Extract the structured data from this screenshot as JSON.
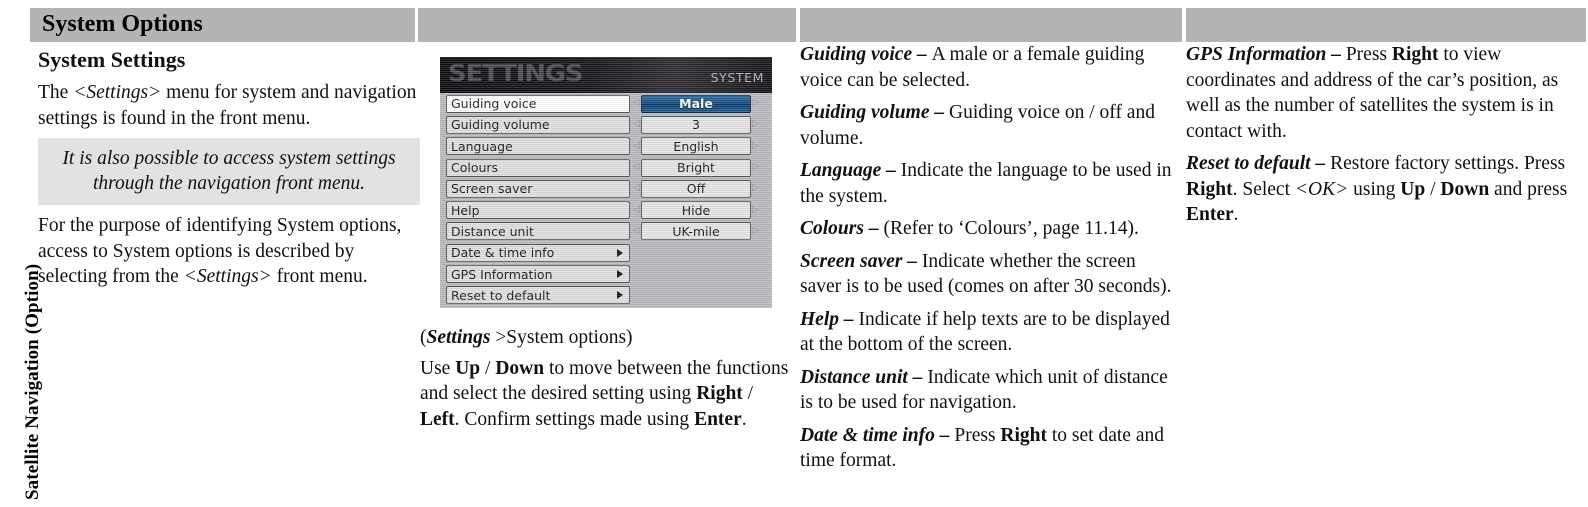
{
  "side_tab": {
    "label": "Satellite Navigation (Option)"
  },
  "headers": [
    {
      "name": "header-bar-1",
      "title": "System Options"
    },
    {
      "name": "header-bar-2",
      "title": ""
    },
    {
      "name": "header-bar-3",
      "title": ""
    },
    {
      "name": "header-bar-4",
      "title": ""
    }
  ],
  "column1": {
    "heading": "System Settings",
    "para1_a": "The ",
    "para1_menu": "<Settings>",
    "para1_b": " menu for system and navigation settings is found in the front menu.",
    "note": "It is also possible to access system settings through the navigation front menu.",
    "para2_a": "For the purpose of identifying System options, access to System options is described by selecting from the ",
    "para2_menu": "<Settings>",
    "para2_b": " front menu."
  },
  "screen": {
    "brand": "SETTINGS",
    "mode": "SYSTEM",
    "highlight_color": "#134a7d",
    "rows": [
      {
        "label": "Guiding voice",
        "value": "Male",
        "selected": true,
        "highlighted": true,
        "submenu": false
      },
      {
        "label": "Guiding volume",
        "value": "3",
        "selected": false,
        "highlighted": false,
        "submenu": false
      },
      {
        "label": "Language",
        "value": "English",
        "selected": false,
        "highlighted": false,
        "submenu": false
      },
      {
        "label": "Colours",
        "value": "Bright",
        "selected": false,
        "highlighted": false,
        "submenu": false
      },
      {
        "label": "Screen saver",
        "value": "Off",
        "selected": false,
        "highlighted": false,
        "submenu": false
      },
      {
        "label": "Help",
        "value": "Hide",
        "selected": false,
        "highlighted": false,
        "submenu": false
      },
      {
        "label": "Distance unit",
        "value": "UK-mile",
        "selected": false,
        "highlighted": false,
        "submenu": false
      },
      {
        "label": "Date & time info",
        "value": "",
        "selected": false,
        "highlighted": false,
        "submenu": true
      },
      {
        "label": "GPS Information",
        "value": "",
        "selected": false,
        "highlighted": false,
        "submenu": true
      },
      {
        "label": "Reset to default",
        "value": "",
        "selected": false,
        "highlighted": false,
        "submenu": true
      }
    ]
  },
  "caption": {
    "breadcrumb_open": "(",
    "breadcrumb_bold": "Settings",
    "breadcrumb_rest": " >System options)",
    "body_1": "Use ",
    "key_up": "Up",
    "slash_1": " / ",
    "key_down": "Down",
    "body_2": " to move between the functions and select the desired setting using ",
    "key_right": "Right",
    "slash_2": " / ",
    "key_left": "Left",
    "body_3": ". Confirm settings made using ",
    "key_enter": "Enter",
    "body_4": "."
  },
  "column3": {
    "items": [
      {
        "term": "Guiding voice",
        "dash": " – ",
        "text": "A male or a female guiding voice can be selected."
      },
      {
        "term": "Guiding volume",
        "dash": " – ",
        "text": "Guiding voice on / off and volume."
      },
      {
        "term": "Language",
        "dash": " – ",
        "text": "Indicate the language to be used in the system."
      },
      {
        "term": "Colours",
        "dash": " – ",
        "text": "(Refer to ‘Colours’, page 11.14)."
      },
      {
        "term": "Screen saver",
        "dash": " – ",
        "text": "Indicate whether the screen saver is to be used (comes on after 30 seconds)."
      },
      {
        "term": "Help",
        "dash": " – ",
        "text": "Indicate if help texts are to be displayed at the bottom of the screen."
      },
      {
        "term": "Distance unit",
        "dash": " – ",
        "text": "Indicate which unit of distance is to be used for navigation."
      },
      {
        "term": "Date & time info",
        "dash": " – ",
        "text_pre": "Press ",
        "key": "Right",
        "text_post": " to set date and time format."
      }
    ]
  },
  "column4": {
    "gps": {
      "term": "GPS Information",
      "dash": " – ",
      "text_pre": "Press ",
      "key": "Right",
      "text_post": " to view coordinates and address of the car’s position, as well as the number of satellites the system is in contact with."
    },
    "reset": {
      "term": "Reset to default",
      "dash": " – ",
      "t1": "Restore factory settings. Press ",
      "k1": "Right",
      "t2": ". Select ",
      "menu": "<OK>",
      "t3": " using ",
      "k2": "Up",
      "t4": " / ",
      "k3": "Down",
      "t5": " and press ",
      "k4": "Enter",
      "t6": "."
    }
  }
}
